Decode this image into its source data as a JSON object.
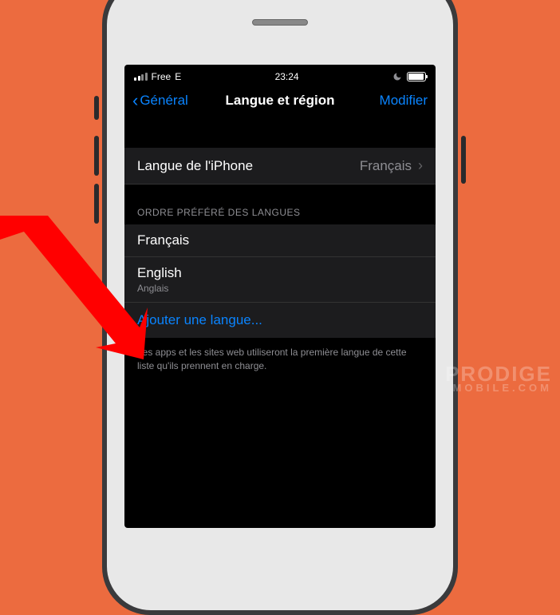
{
  "status": {
    "carrier": "Free",
    "network": "E",
    "time": "23:24"
  },
  "nav": {
    "back": "Général",
    "title": "Langue et région",
    "edit": "Modifier"
  },
  "phoneLang": {
    "label": "Langue de l'iPhone",
    "value": "Français"
  },
  "sectionHeader": "ORDRE PRÉFÉRÉ DES LANGUES",
  "languages": [
    {
      "name": "Français",
      "sub": ""
    },
    {
      "name": "English",
      "sub": "Anglais"
    }
  ],
  "addLanguage": "Ajouter une langue...",
  "footer": "Les apps et les sites web utiliseront la première langue de cette liste qu'ils prennent en charge.",
  "watermark": {
    "top": "PRODIGE",
    "bottom": "MOBILE.COM"
  }
}
